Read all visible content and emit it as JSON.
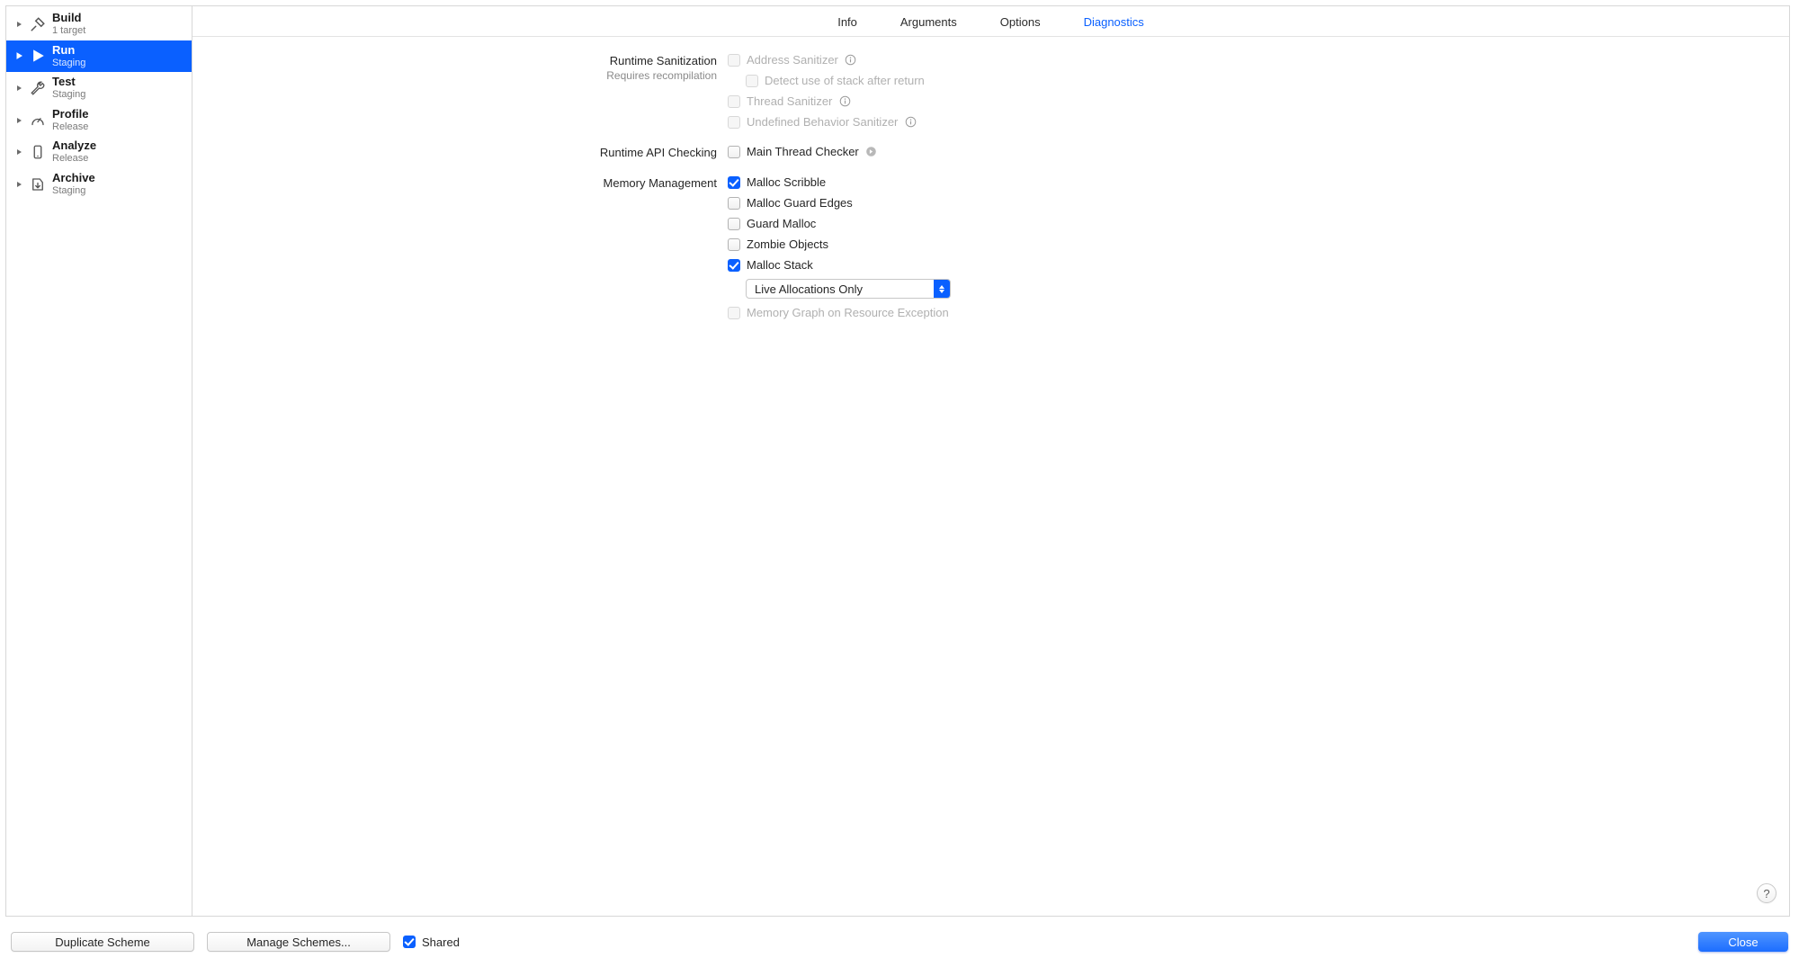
{
  "sidebar": {
    "items": [
      {
        "title": "Build",
        "sub": "1 target"
      },
      {
        "title": "Run",
        "sub": "Staging"
      },
      {
        "title": "Test",
        "sub": "Staging"
      },
      {
        "title": "Profile",
        "sub": "Release"
      },
      {
        "title": "Analyze",
        "sub": "Release"
      },
      {
        "title": "Archive",
        "sub": "Staging"
      }
    ]
  },
  "tabs": {
    "info": "Info",
    "arguments": "Arguments",
    "options": "Options",
    "diagnostics": "Diagnostics"
  },
  "sections": {
    "runtime_sanitization": {
      "label": "Runtime Sanitization",
      "sublabel": "Requires recompilation",
      "address_sanitizer": "Address Sanitizer",
      "detect_stack_after_return": "Detect use of stack after return",
      "thread_sanitizer": "Thread Sanitizer",
      "undefined_behavior": "Undefined Behavior Sanitizer"
    },
    "runtime_api": {
      "label": "Runtime API Checking",
      "main_thread_checker": "Main Thread Checker"
    },
    "memory": {
      "label": "Memory Management",
      "malloc_scribble": "Malloc Scribble",
      "malloc_guard_edges": "Malloc Guard Edges",
      "guard_malloc": "Guard Malloc",
      "zombie_objects": "Zombie Objects",
      "malloc_stack": "Malloc Stack",
      "malloc_stack_mode": "Live Allocations Only",
      "memory_graph_exception": "Memory Graph on Resource Exception"
    }
  },
  "footer": {
    "duplicate": "Duplicate Scheme",
    "manage": "Manage Schemes...",
    "shared": "Shared",
    "close": "Close"
  },
  "help": "?"
}
